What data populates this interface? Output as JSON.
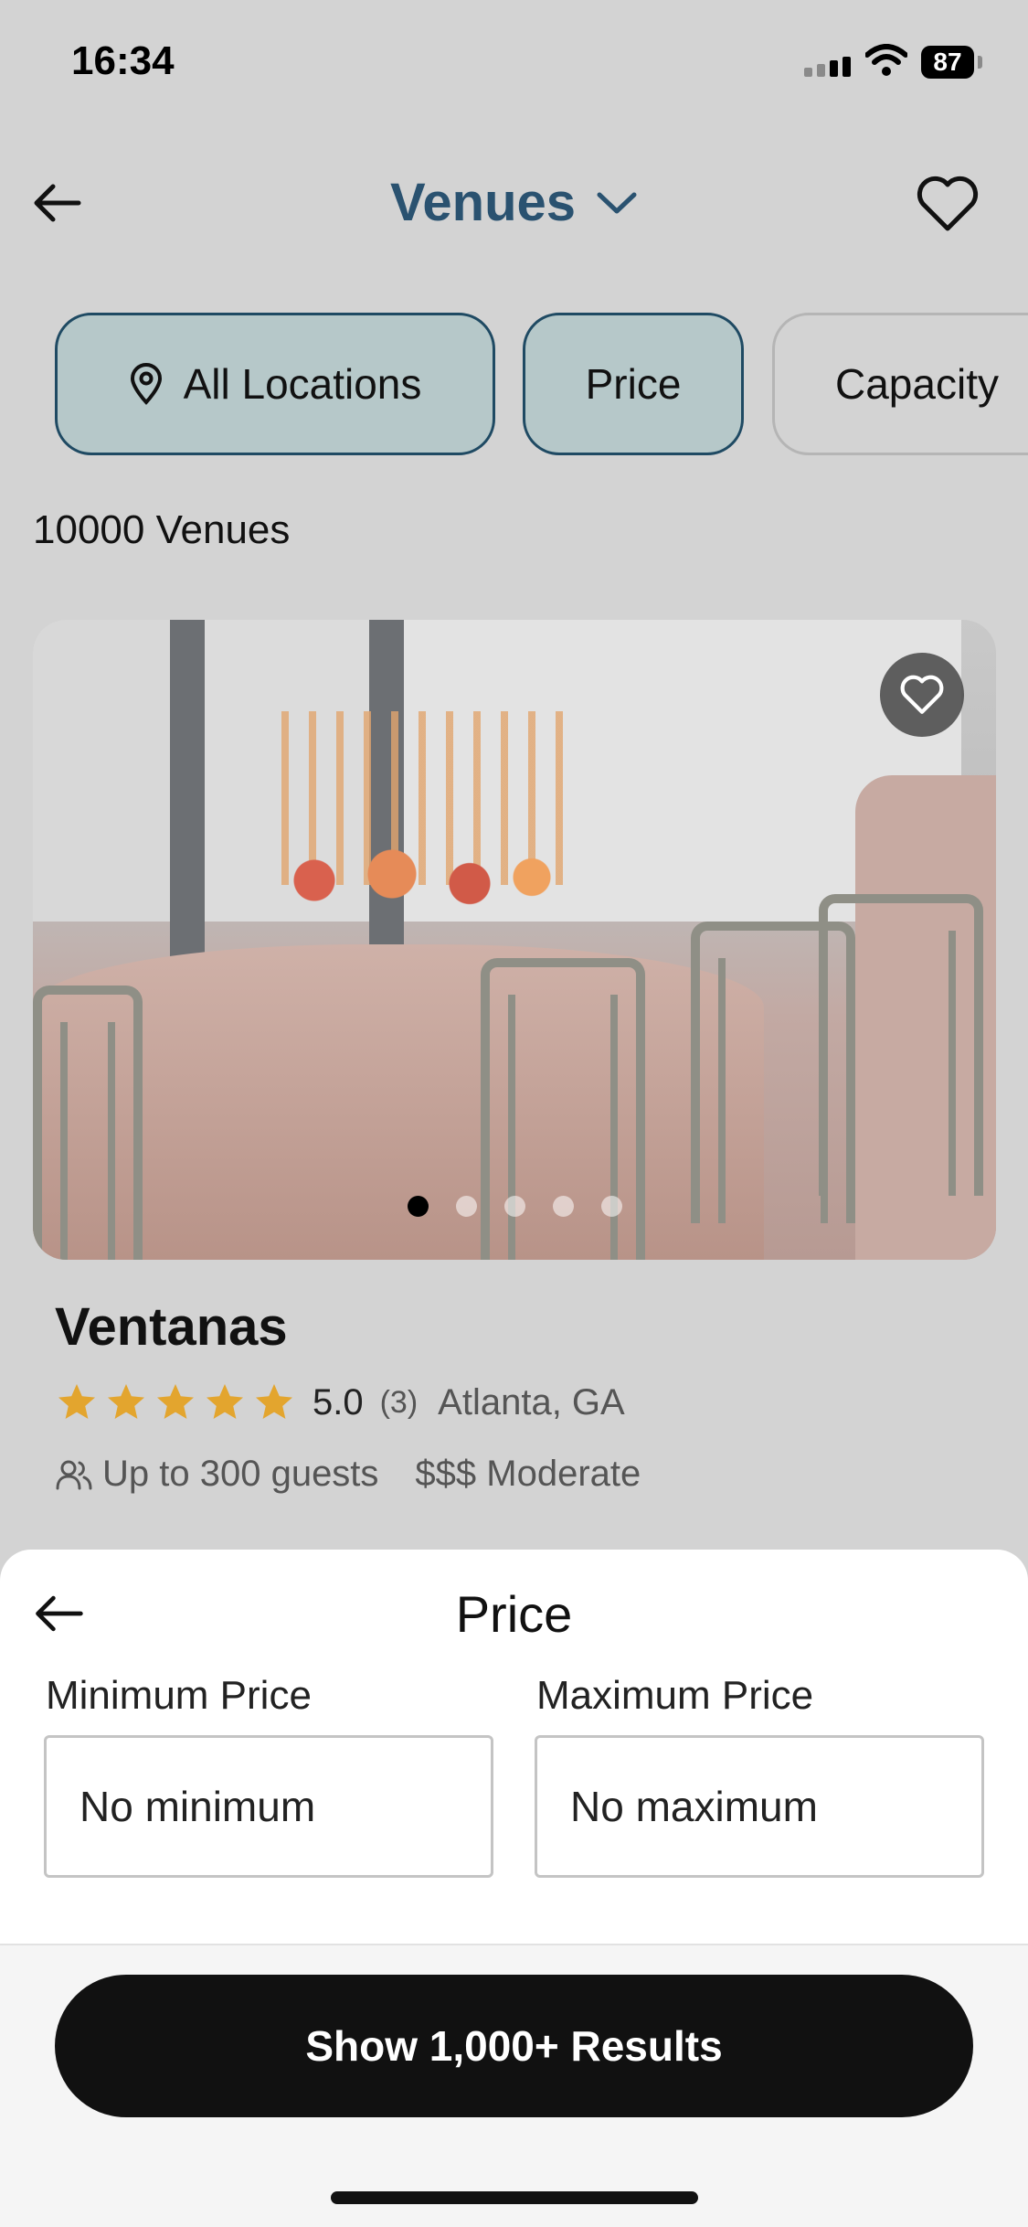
{
  "status_bar": {
    "time": "16:34",
    "battery": "87"
  },
  "header": {
    "title": "Venues"
  },
  "filters": [
    {
      "label": "All Locations"
    },
    {
      "label": "Price"
    },
    {
      "label": "Capacity"
    }
  ],
  "results": {
    "count_label": "10000 Venues"
  },
  "venue": {
    "name": "Ventanas",
    "rating": "5.0",
    "review_count": "(3)",
    "location": "Atlanta, GA",
    "guests": "Up to 300 guests",
    "price_tier": "$$$ Moderate",
    "photo_page": 1,
    "photo_total": 5
  },
  "sheet": {
    "title": "Price",
    "min_label": "Minimum Price",
    "max_label": "Maximum Price",
    "min_value": "No minimum",
    "max_value": "No maximum",
    "cta_label": "Show 1,000+ Results"
  },
  "colors": {
    "accent": "#2a5270",
    "chip_fill": "#b6c8c9",
    "star": "#e3a52e",
    "cta": "#111111"
  }
}
